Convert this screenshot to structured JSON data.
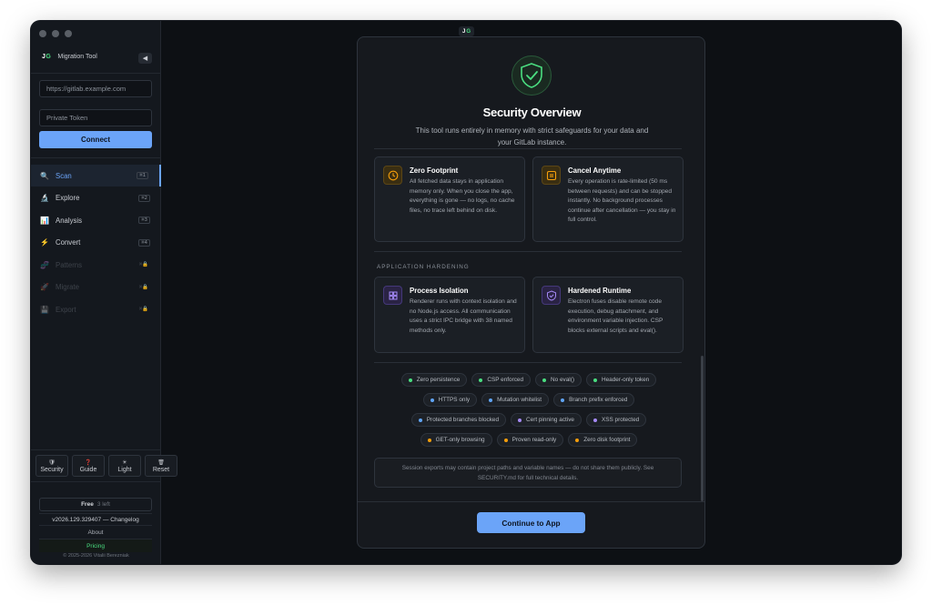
{
  "colors": {
    "accent": "#6ba4f8",
    "green": "#4ade80",
    "blue": "#60a5fa",
    "purple": "#a78bfa",
    "amber": "#f59e0b"
  },
  "topbar": {
    "logo_j": "J",
    "logo_g": "G"
  },
  "sidebar": {
    "brand": {
      "logo_j": "J",
      "logo_g": "G",
      "title": "Migration Tool"
    },
    "url_placeholder": "https://gitlab.example.com",
    "token_placeholder": "Private Token",
    "connect_label": "Connect",
    "items": [
      {
        "label": "Scan",
        "icon": "magnifier-icon",
        "glyph": "🔍",
        "shortcut": "⌘1",
        "state": "active"
      },
      {
        "label": "Explore",
        "icon": "microscope-icon",
        "glyph": "🔬",
        "shortcut": "⌘2",
        "state": "enabled"
      },
      {
        "label": "Analysis",
        "icon": "bar-chart-icon",
        "glyph": "📊",
        "shortcut": "⌘3",
        "state": "enabled"
      },
      {
        "label": "Convert",
        "icon": "lightning-icon",
        "glyph": "⚡",
        "shortcut": "⌘4",
        "state": "enabled"
      },
      {
        "label": "Patterns",
        "icon": "dna-icon",
        "glyph": "🧬",
        "shortcut": "⌘🔒",
        "state": "locked"
      },
      {
        "label": "Migrate",
        "icon": "rocket-icon",
        "glyph": "🚀",
        "shortcut": "⌘🔒",
        "state": "locked"
      },
      {
        "label": "Export",
        "icon": "floppy-disk-icon",
        "glyph": "💾",
        "shortcut": "⌘🔒",
        "state": "locked"
      }
    ],
    "bottom_buttons": [
      {
        "label": "Security",
        "icon": "shield-icon",
        "glyph": "🛡"
      },
      {
        "label": "Guide",
        "icon": "question-icon",
        "glyph": "❓"
      },
      {
        "label": "Light",
        "icon": "sun-icon",
        "glyph": "☀"
      },
      {
        "label": "Reset",
        "icon": "trash-icon",
        "glyph": "🗑"
      }
    ],
    "plan": {
      "name": "Free",
      "remaining": "3 left"
    },
    "version": "v2026.129.329407 — Changelog",
    "about": "About",
    "pricing": "Pricing",
    "copyright": "© 2025-2026 Vitalii Berezniak"
  },
  "modal": {
    "title": "Security Overview",
    "subtitle": "This tool runs entirely in memory with strict safeguards for your data and your GitLab instance.",
    "cards_top": [
      {
        "title": "Zero Footprint",
        "icon": "clock-icon",
        "body": "All fetched data stays in application memory only. When you close the app, everything is gone — no logs, no cache files, no trace left behind on disk."
      },
      {
        "title": "Cancel Anytime",
        "icon": "pause-icon",
        "body": "Every operation is rate-limited (50 ms between requests) and can be stopped instantly. No background processes continue after cancellation — you stay in full control."
      }
    ],
    "section_label": "APPLICATION HARDENING",
    "cards_bottom": [
      {
        "title": "Process Isolation",
        "icon": "grid-icon",
        "body": "Renderer runs with context isolation and no Node.js access. All communication uses a strict IPC bridge with 38 named methods only."
      },
      {
        "title": "Hardened Runtime",
        "icon": "shield-check-icon",
        "body": "Electron fuses disable remote code execution, debug attachment, and environment variable injection. CSP blocks external scripts and eval()."
      }
    ],
    "pills": [
      [
        {
          "label": "Zero persistence",
          "color": "green"
        },
        {
          "label": "CSP enforced",
          "color": "green"
        },
        {
          "label": "No eval()",
          "color": "green"
        },
        {
          "label": "Header-only token",
          "color": "green"
        }
      ],
      [
        {
          "label": "HTTPS only",
          "color": "blue"
        },
        {
          "label": "Mutation whitelist",
          "color": "blue"
        },
        {
          "label": "Branch prefix enforced",
          "color": "blue"
        }
      ],
      [
        {
          "label": "Protected branches blocked",
          "color": "blue"
        },
        {
          "label": "Cert pinning active",
          "color": "purple"
        },
        {
          "label": "XSS protected",
          "color": "purple"
        }
      ],
      [
        {
          "label": "GET-only browsing",
          "color": "amber"
        },
        {
          "label": "Proven read-only",
          "color": "amber"
        },
        {
          "label": "Zero disk footprint",
          "color": "amber"
        }
      ]
    ],
    "note": "Session exports may contain project paths and variable names — do not share them publicly. See SECURITY.md for full technical details.",
    "continue_label": "Continue to App"
  }
}
